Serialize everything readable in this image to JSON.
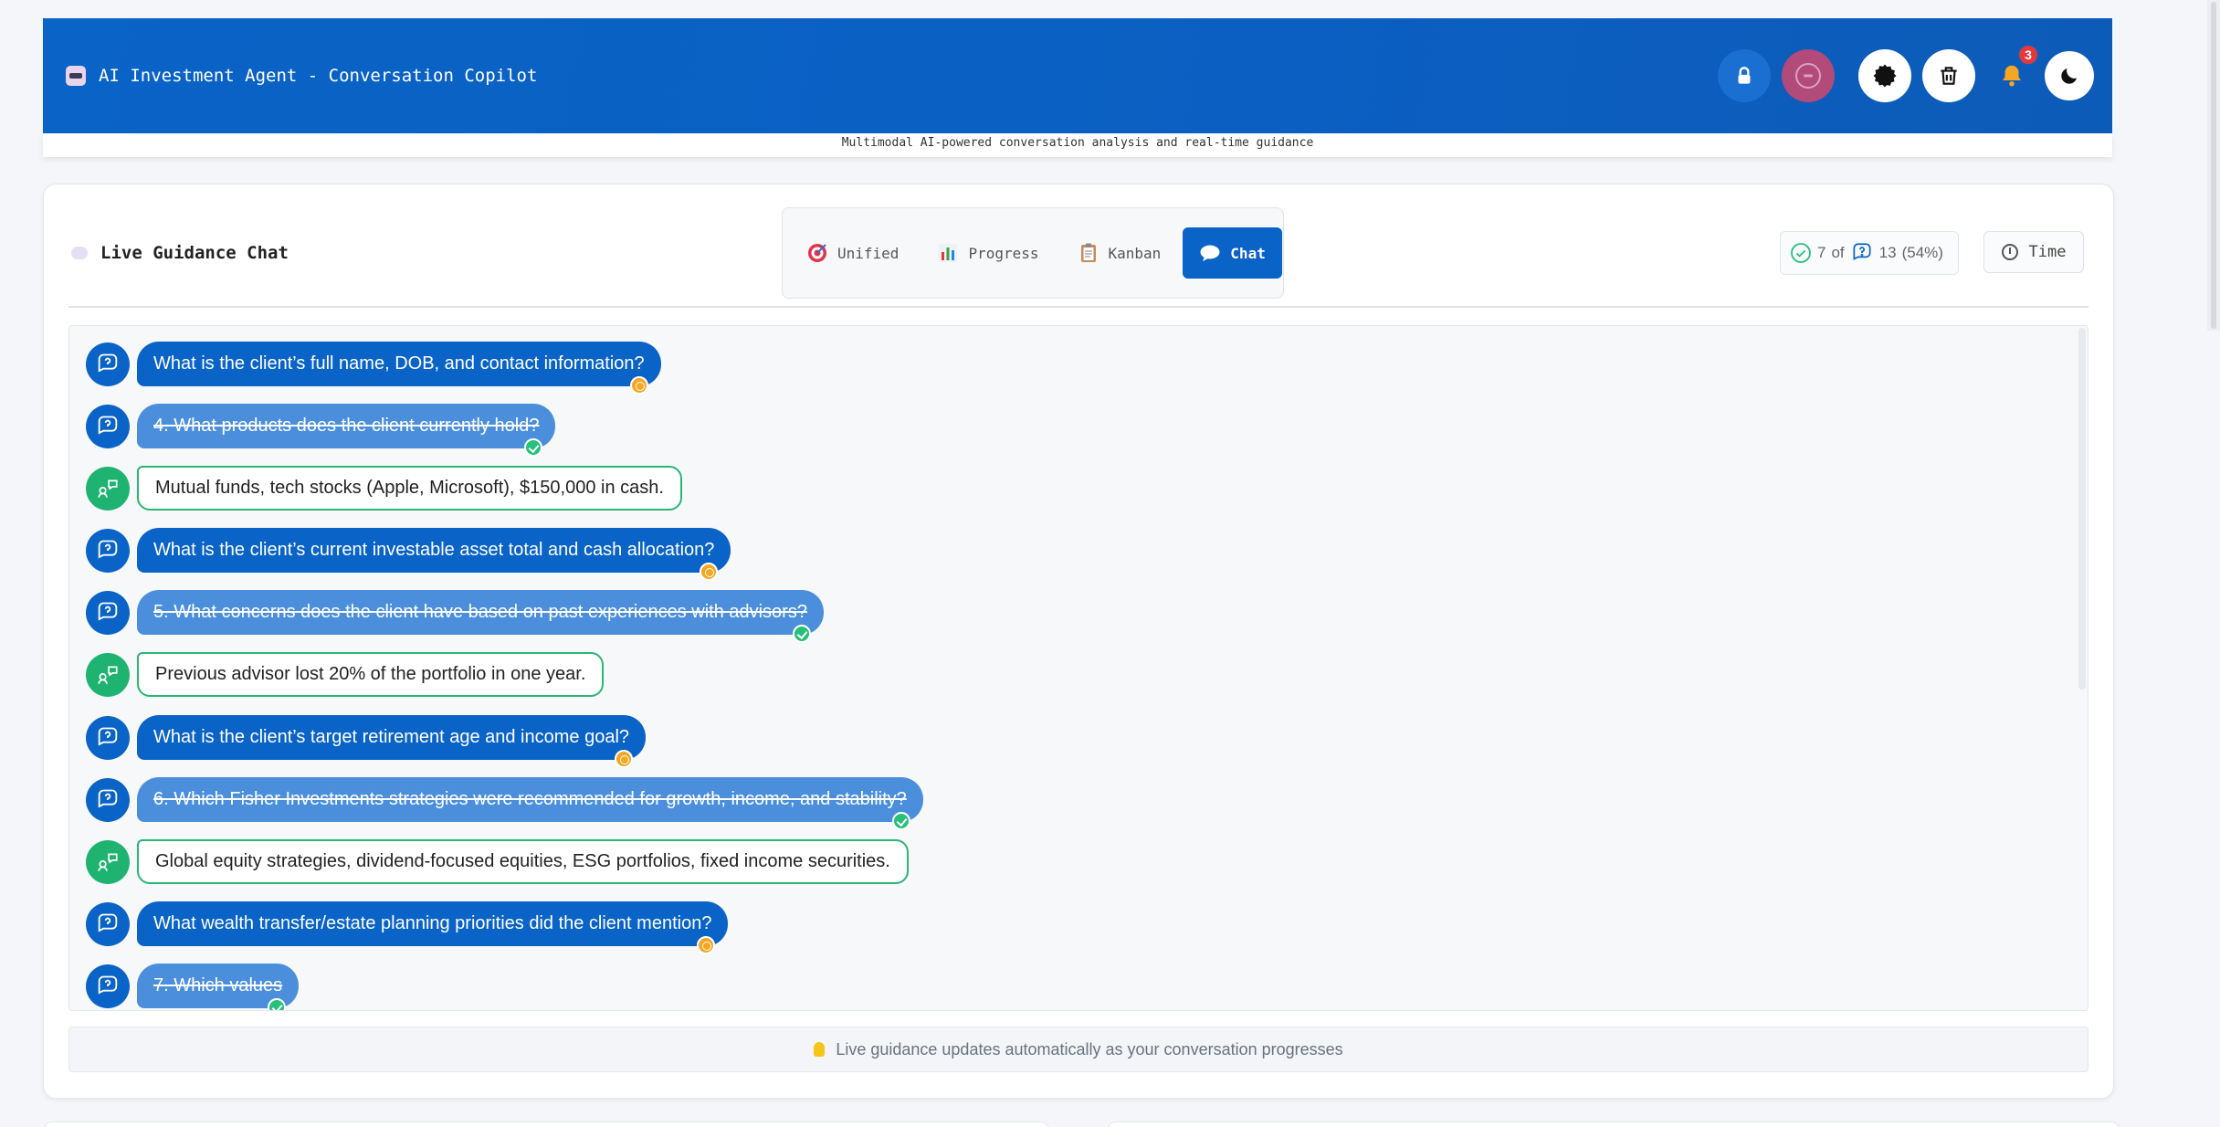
{
  "header": {
    "title": "AI Investment Agent - Conversation Copilot",
    "subtitle": "Multimodal AI-powered conversation analysis and real-time guidance",
    "notification_count": "3",
    "icons": [
      "robot-logo-icon",
      "lock-icon",
      "stop-recording-icon",
      "settings-gear-icon",
      "trash-icon",
      "bell-icon",
      "moon-icon"
    ]
  },
  "panel": {
    "title": "Live Guidance Chat",
    "tabs": [
      {
        "label": "Unified",
        "icon": "target-icon"
      },
      {
        "label": "Progress",
        "icon": "bar-chart-icon"
      },
      {
        "label": "Kanban",
        "icon": "clipboard-icon"
      },
      {
        "label": "Chat",
        "icon": "speech-bubble-icon",
        "active": true
      }
    ],
    "stats": {
      "answered": "7",
      "of": "of",
      "total": "13",
      "percent": "(54%)"
    },
    "time_label": "Time"
  },
  "messages": [
    {
      "type": "question",
      "status": "pending",
      "text": "What is the client’s full name, DOB, and contact information?"
    },
    {
      "type": "question",
      "status": "answered",
      "text": "4. What products does the client currently hold?"
    },
    {
      "type": "answer",
      "text": "Mutual funds, tech stocks (Apple, Microsoft), $150,000 in cash."
    },
    {
      "type": "question",
      "status": "pending",
      "text": "What is the client’s current investable asset total and cash allocation?"
    },
    {
      "type": "question",
      "status": "answered",
      "text": "5. What concerns does the client have based on past experiences with advisors?"
    },
    {
      "type": "answer",
      "text": "Previous advisor lost 20% of the portfolio in one year."
    },
    {
      "type": "question",
      "status": "pending",
      "text": "What is the client’s target retirement age and income goal?"
    },
    {
      "type": "question",
      "status": "answered",
      "text": "6. Which Fisher Investments strategies were recommended for growth, income, and stability?"
    },
    {
      "type": "answer",
      "text": "Global equity strategies, dividend-focused equities, ESG portfolios, fixed income securities."
    },
    {
      "type": "question",
      "status": "pending",
      "text": "What wealth transfer/estate planning priorities did the client mention?"
    },
    {
      "type": "question",
      "status": "answered",
      "text": "7. Which values"
    }
  ],
  "footer": {
    "text": "Live guidance updates automatically as your conversation progresses"
  },
  "colors": {
    "primary": "#0a63c6",
    "answered_bubble": "#4b8fdc",
    "answer_border": "#2bb673",
    "pending": "#f5a623",
    "ok": "#27c07a",
    "badge": "#e5383b"
  }
}
